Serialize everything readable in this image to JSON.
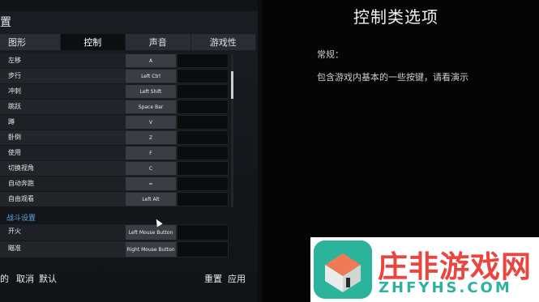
{
  "top_strip": [
    "",
    ""
  ],
  "settings_title": "置",
  "tabs": [
    "图形",
    "控制",
    "声音",
    "游戏性"
  ],
  "rows": [
    {
      "label": "左移",
      "key": "A"
    },
    {
      "label": "步行",
      "key": "Left Ctrl"
    },
    {
      "label": "冲刺",
      "key": "Left Shift"
    },
    {
      "label": "跳跃",
      "key": "Space Bar"
    },
    {
      "label": "蹲",
      "key": "V"
    },
    {
      "label": "卧倒",
      "key": "Z"
    },
    {
      "label": "使用",
      "key": "F"
    },
    {
      "label": "切换视角",
      "key": "C"
    },
    {
      "label": "自动奔跑",
      "key": "="
    },
    {
      "label": "自由观看",
      "key": "Left Alt"
    }
  ],
  "combat_section": "战斗设置",
  "combat_rows": [
    {
      "label": "开火",
      "key": "Left Mouse Button"
    },
    {
      "label": "瞄准",
      "key": "Right Mouse Button"
    }
  ],
  "bottom": {
    "left_fragment": "的",
    "cancel": "取消",
    "default": "默认",
    "reset": "重置",
    "apply": "应用"
  },
  "info": {
    "title": "控制类选项",
    "subtitle": "常规：",
    "description": "包含游戏内基本的一些按键，请看演示"
  },
  "watermark": {
    "name": "庄非游戏网",
    "url": "ZHFYHS.COM"
  },
  "colors": {
    "accent_blue": "#5aa6e0",
    "active_tab": "#0d0e10",
    "watermark_red": "#e8463f",
    "watermark_teal": "#2bb39c"
  }
}
